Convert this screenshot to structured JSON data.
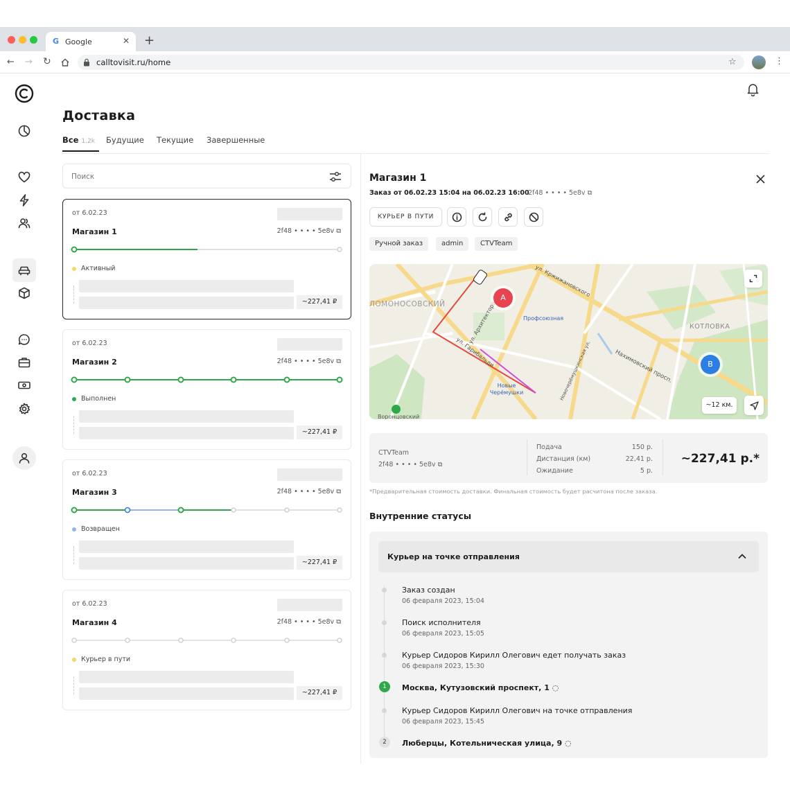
{
  "browser": {
    "tab_title": "Google",
    "url": "calltovisit.ru/home"
  },
  "page": {
    "title": "Доставка",
    "tabs": [
      {
        "label": "Все",
        "count": "1.2k"
      },
      {
        "label": "Будущие"
      },
      {
        "label": "Текущие"
      },
      {
        "label": "Завершенные"
      }
    ]
  },
  "search": {
    "placeholder": "Поиск"
  },
  "orders": [
    {
      "date": "от 6.02.23",
      "name": "Магазин 1",
      "id": "2f48 • • • • 5e8v",
      "status": "Активный",
      "status_color": "#f5d867",
      "price": "~227,41 ₽"
    },
    {
      "date": "от 6.02.23",
      "name": "Магазин 2",
      "id": "2f48 • • • • 5e8v",
      "status": "Выполнен",
      "status_color": "#2ea84a",
      "price": "~227,41 ₽"
    },
    {
      "date": "от 6.02.23",
      "name": "Магазин 3",
      "id": "2f48 • • • • 5e8v",
      "status": "Возвращен",
      "status_color": "#8fb5e8",
      "price": "~227,41 ₽"
    },
    {
      "date": "от 6.02.23",
      "name": "Магазин 4",
      "id": "2f48 • • • • 5e8v",
      "status": "Курьер в пути",
      "status_color": "#f5d867",
      "price": "~227,41 ₽"
    }
  ],
  "detail": {
    "title": "Магазин 1",
    "subtitle": "Заказ от 06.02.23 15:04 на 06.02.23 16:00",
    "id": "2f48 • • • • 5e8v",
    "status_button": "КУРЬЕР В ПУТИ",
    "tags": [
      "Ручной заказ",
      "admin",
      "CTVTeam"
    ],
    "map": {
      "labels": [
        "ЛОМОНОСОВСКИЙ",
        "Профсоюзная",
        "Новые Черёмушки",
        "КОТЛОВКА",
        "Нахимовский просп.",
        "ул. Гарибальди",
        "ул. Кржижановского",
        "ул. Архитектора",
        "Новочерёмушкинская ул.",
        "Воронцовский"
      ],
      "distance_badge": "~12 км.",
      "markers": [
        "A",
        "B"
      ]
    },
    "summary": {
      "team": "CTVTeam",
      "id": "2f48 • • • • 5e8v",
      "rows": [
        {
          "label": "Подача",
          "value": "150 р."
        },
        {
          "label": "Дистанция (км)",
          "value": "22,41 р."
        },
        {
          "label": "Ожидание",
          "value": "5 р."
        }
      ],
      "total": "~227,41 р.*"
    },
    "disclaimer": "*Предварительная стоимость доставки. Финальная стоимость будет расчитона после заказа.",
    "internal_title": "Внутренние статусы",
    "accordion_title": "Курьер на точке отправления",
    "timeline": [
      {
        "title": "Заказ создан",
        "date": "06 февраля 2023, 15:04"
      },
      {
        "title": "Поиск исполнителя",
        "date": "06 февраля 2023, 15:05"
      },
      {
        "title": "Курьер Сидоров Кирилл Олегович едет получать заказ",
        "date": "06 февраля 2023, 15:30"
      },
      {
        "title": "Москва, Кутузовский проспект, 1",
        "point": "1"
      },
      {
        "title": "Курьер Сидоров Кирилл Олегович на точке отправления",
        "date": "06 февраля 2023, 15:45"
      },
      {
        "title": "Люберцы, Котельническая улица, 9",
        "point": "2"
      }
    ]
  },
  "colors": {
    "accent_green": "#2ea84a",
    "marker_red": "#e8444f",
    "marker_blue": "#2d7ee3",
    "route_red": "#e44b3d",
    "route_pink": "#d04ed6"
  }
}
